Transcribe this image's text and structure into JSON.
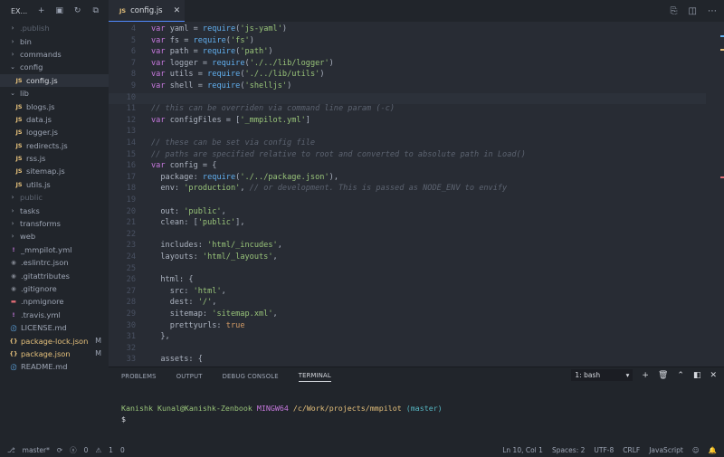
{
  "sidebar": {
    "header": {
      "title": "EX..."
    },
    "items": [
      {
        "label": ".publish",
        "kind": "folder",
        "state": "dim"
      },
      {
        "label": "bin",
        "kind": "folder"
      },
      {
        "label": "commands",
        "kind": "folder"
      },
      {
        "label": "config",
        "kind": "folder-open"
      },
      {
        "label": "config.js",
        "kind": "js",
        "indent": 1,
        "active": true
      },
      {
        "label": "lib",
        "kind": "folder-open"
      },
      {
        "label": "blogs.js",
        "kind": "js",
        "indent": 1
      },
      {
        "label": "data.js",
        "kind": "js",
        "indent": 1
      },
      {
        "label": "logger.js",
        "kind": "js",
        "indent": 1
      },
      {
        "label": "redirects.js",
        "kind": "js",
        "indent": 1
      },
      {
        "label": "rss.js",
        "kind": "js",
        "indent": 1
      },
      {
        "label": "sitemap.js",
        "kind": "js",
        "indent": 1
      },
      {
        "label": "utils.js",
        "kind": "js",
        "indent": 1
      },
      {
        "label": "public",
        "kind": "folder",
        "state": "dim"
      },
      {
        "label": "tasks",
        "kind": "folder"
      },
      {
        "label": "transforms",
        "kind": "folder"
      },
      {
        "label": "web",
        "kind": "folder"
      },
      {
        "label": "_mmpilot.yml",
        "kind": "yml"
      },
      {
        "label": ".eslintrc.json",
        "kind": "cfg"
      },
      {
        "label": ".gitattributes",
        "kind": "cfg"
      },
      {
        "label": ".gitignore",
        "kind": "cfg"
      },
      {
        "label": ".npmignore",
        "kind": "npm"
      },
      {
        "label": ".travis.yml",
        "kind": "yml"
      },
      {
        "label": "LICENSE.md",
        "kind": "md"
      },
      {
        "label": "package-lock.json",
        "kind": "json",
        "git": "M"
      },
      {
        "label": "package.json",
        "kind": "json",
        "git": "M"
      },
      {
        "label": "README.md",
        "kind": "md"
      }
    ]
  },
  "tab": {
    "label": "config.js",
    "icon": "JS",
    "close": "✕"
  },
  "editor": {
    "current_line": 10,
    "lines": [
      {
        "n": "4",
        "tokens": [
          [
            "kw",
            "var "
          ],
          [
            "prop",
            "yaml = "
          ],
          [
            "fn",
            "require"
          ],
          [
            "prop",
            "("
          ],
          [
            "str",
            "'js-yaml'"
          ],
          [
            "prop",
            ")"
          ]
        ]
      },
      {
        "n": "5",
        "tokens": [
          [
            "kw",
            "var "
          ],
          [
            "prop",
            "fs = "
          ],
          [
            "fn",
            "require"
          ],
          [
            "prop",
            "("
          ],
          [
            "str",
            "'fs'"
          ],
          [
            "prop",
            ")"
          ]
        ]
      },
      {
        "n": "6",
        "tokens": [
          [
            "kw",
            "var "
          ],
          [
            "prop",
            "path = "
          ],
          [
            "fn",
            "require"
          ],
          [
            "prop",
            "("
          ],
          [
            "str",
            "'path'"
          ],
          [
            "prop",
            ")"
          ]
        ]
      },
      {
        "n": "7",
        "tokens": [
          [
            "kw",
            "var "
          ],
          [
            "prop",
            "logger = "
          ],
          [
            "fn",
            "require"
          ],
          [
            "prop",
            "("
          ],
          [
            "str",
            "'./../lib/logger'"
          ],
          [
            "prop",
            ")"
          ]
        ]
      },
      {
        "n": "8",
        "tokens": [
          [
            "kw",
            "var "
          ],
          [
            "prop",
            "utils = "
          ],
          [
            "fn",
            "require"
          ],
          [
            "prop",
            "("
          ],
          [
            "str",
            "'./../lib/utils'"
          ],
          [
            "prop",
            ")"
          ]
        ]
      },
      {
        "n": "9",
        "tokens": [
          [
            "kw",
            "var "
          ],
          [
            "prop",
            "shell = "
          ],
          [
            "fn",
            "require"
          ],
          [
            "prop",
            "("
          ],
          [
            "str",
            "'shelljs'"
          ],
          [
            "prop",
            ")"
          ]
        ]
      },
      {
        "n": "10",
        "tokens": []
      },
      {
        "n": "11",
        "tokens": [
          [
            "cm",
            "// this can be overriden via command line param (-c)"
          ]
        ]
      },
      {
        "n": "12",
        "tokens": [
          [
            "kw",
            "var "
          ],
          [
            "prop",
            "configFiles = ["
          ],
          [
            "str",
            "'_mmpilot.yml'"
          ],
          [
            "prop",
            "]"
          ]
        ]
      },
      {
        "n": "13",
        "tokens": []
      },
      {
        "n": "14",
        "tokens": [
          [
            "cm",
            "// these can be set via config file"
          ]
        ]
      },
      {
        "n": "15",
        "tokens": [
          [
            "cm",
            "// paths are specified relative to root and converted to absolute path in Load()"
          ]
        ]
      },
      {
        "n": "16",
        "tokens": [
          [
            "kw",
            "var "
          ],
          [
            "prop",
            "config = {"
          ]
        ]
      },
      {
        "n": "17",
        "tokens": [
          [
            "prop",
            "  package: "
          ],
          [
            "fn",
            "require"
          ],
          [
            "prop",
            "("
          ],
          [
            "str",
            "'./../package.json'"
          ],
          [
            "prop",
            "),"
          ]
        ]
      },
      {
        "n": "18",
        "tokens": [
          [
            "prop",
            "  env: "
          ],
          [
            "str",
            "'production'"
          ],
          [
            "prop",
            ", "
          ],
          [
            "cm",
            "// or development. This is passed as NODE_ENV to envify"
          ]
        ]
      },
      {
        "n": "19",
        "tokens": []
      },
      {
        "n": "20",
        "tokens": [
          [
            "prop",
            "  out: "
          ],
          [
            "str",
            "'public'"
          ],
          [
            "prop",
            ","
          ]
        ]
      },
      {
        "n": "21",
        "tokens": [
          [
            "prop",
            "  clean: ["
          ],
          [
            "str",
            "'public'"
          ],
          [
            "prop",
            "],"
          ]
        ]
      },
      {
        "n": "22",
        "tokens": []
      },
      {
        "n": "23",
        "tokens": [
          [
            "prop",
            "  includes: "
          ],
          [
            "str",
            "'html/_incudes'"
          ],
          [
            "prop",
            ","
          ]
        ]
      },
      {
        "n": "24",
        "tokens": [
          [
            "prop",
            "  layouts: "
          ],
          [
            "str",
            "'html/_layouts'"
          ],
          [
            "prop",
            ","
          ]
        ]
      },
      {
        "n": "25",
        "tokens": []
      },
      {
        "n": "26",
        "tokens": [
          [
            "prop",
            "  html: {"
          ]
        ]
      },
      {
        "n": "27",
        "tokens": [
          [
            "prop",
            "    src: "
          ],
          [
            "str",
            "'html'"
          ],
          [
            "prop",
            ","
          ]
        ]
      },
      {
        "n": "28",
        "tokens": [
          [
            "prop",
            "    dest: "
          ],
          [
            "str",
            "'/'"
          ],
          [
            "prop",
            ","
          ]
        ]
      },
      {
        "n": "29",
        "tokens": [
          [
            "prop",
            "    sitemap: "
          ],
          [
            "str",
            "'sitemap.xml'"
          ],
          [
            "prop",
            ","
          ]
        ]
      },
      {
        "n": "30",
        "tokens": [
          [
            "prop",
            "    prettyurls: "
          ],
          [
            "bool",
            "true"
          ]
        ]
      },
      {
        "n": "31",
        "tokens": [
          [
            "prop",
            "  },"
          ]
        ]
      },
      {
        "n": "32",
        "tokens": []
      },
      {
        "n": "33",
        "tokens": [
          [
            "prop",
            "  assets: {"
          ]
        ]
      }
    ]
  },
  "panel": {
    "tabs": [
      "PROBLEMS",
      "OUTPUT",
      "DEBUG CONSOLE",
      "TERMINAL"
    ],
    "active_tab": "TERMINAL",
    "terminal_select": "1: bash",
    "terminal": {
      "user": "Kanishk Kunal@Kanishk-Zenbook",
      "system": "MINGW64",
      "path": "/c/Work/projects/mmpilot",
      "branch": "(master)",
      "prompt": "$"
    }
  },
  "status": {
    "branch": "master*",
    "errors": "0",
    "warnings": "1",
    "info": "0",
    "position": "Ln 10, Col 1",
    "spaces": "Spaces: 2",
    "encoding": "UTF-8",
    "eol": "CRLF",
    "language": "JavaScript"
  }
}
